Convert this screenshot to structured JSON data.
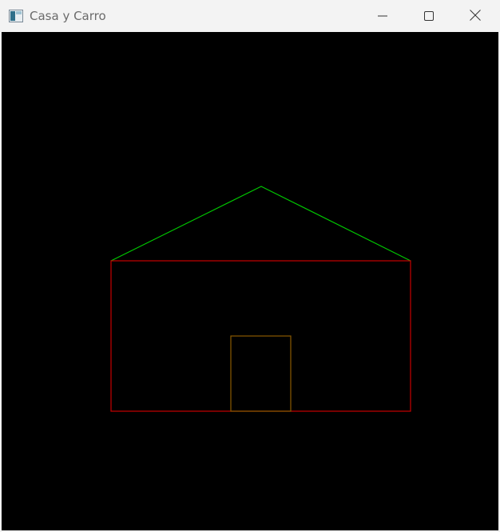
{
  "window": {
    "title": "Casa y Carro",
    "icon": "app-window-icon",
    "controls": {
      "minimize_icon": "minimize-icon",
      "maximize_icon": "maximize-icon",
      "close_icon": "close-icon"
    }
  },
  "canvas": {
    "background": "#000000",
    "colors": {
      "roof": "#00c800",
      "walls": "#c80000",
      "door": "#8a5a00"
    }
  }
}
